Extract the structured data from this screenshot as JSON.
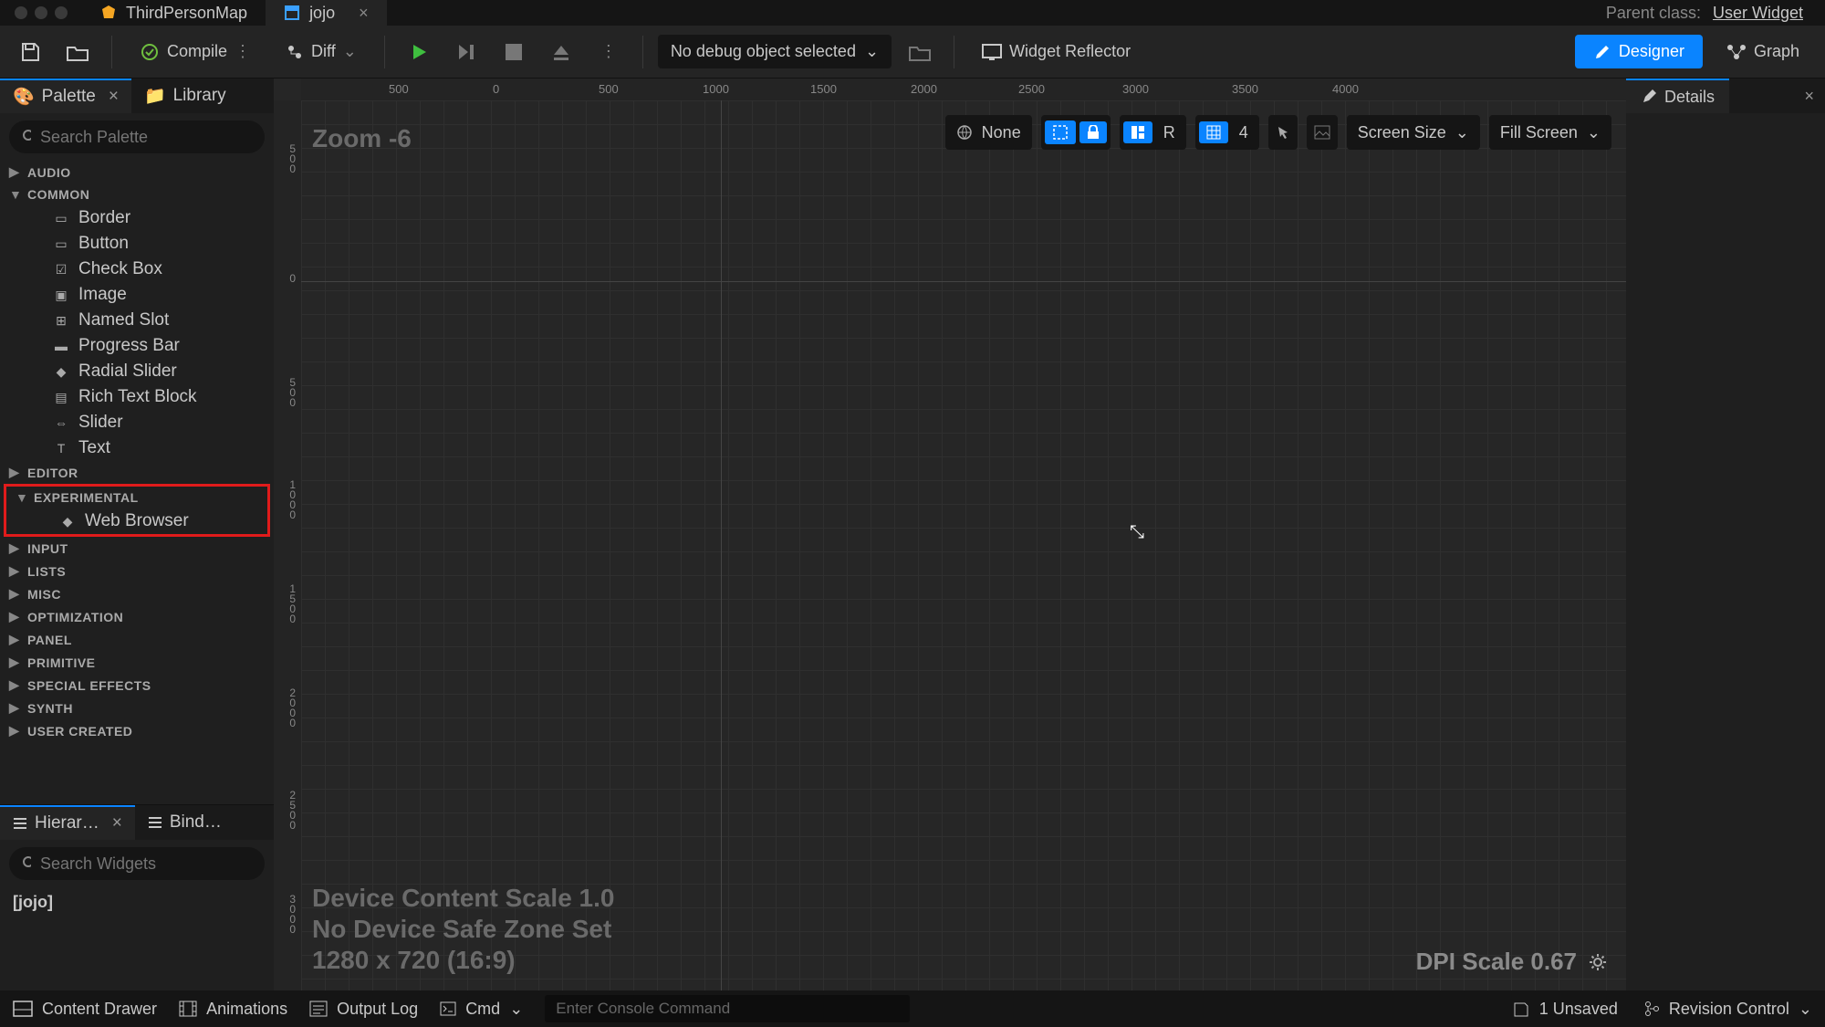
{
  "tabs": {
    "map": "ThirdPersonMap",
    "widget": "jojo"
  },
  "parent": {
    "label": "Parent class:",
    "value": "User Widget"
  },
  "toolbar": {
    "compile": "Compile",
    "diff": "Diff",
    "debug": "No debug object selected",
    "reflector": "Widget Reflector",
    "designer": "Designer",
    "graph": "Graph"
  },
  "palette": {
    "tab": "Palette",
    "library": "Library",
    "search_ph": "Search Palette",
    "cats": {
      "audio": "AUDIO",
      "common": "COMMON",
      "common_items": [
        "Border",
        "Button",
        "Check Box",
        "Image",
        "Named Slot",
        "Progress Bar",
        "Radial Slider",
        "Rich Text Block",
        "Slider",
        "Text"
      ],
      "editor": "EDITOR",
      "experimental": "EXPERIMENTAL",
      "experimental_items": [
        "Web Browser"
      ],
      "rest": [
        "INPUT",
        "LISTS",
        "MISC",
        "OPTIMIZATION",
        "PANEL",
        "PRIMITIVE",
        "SPECIAL EFFECTS",
        "SYNTH",
        "USER CREATED"
      ]
    }
  },
  "hierarchy": {
    "tab": "Hierar…",
    "bind": "Bind…",
    "search_ph": "Search Widgets",
    "root": "[jojo]"
  },
  "canvas": {
    "zoom": "Zoom -6",
    "h_ticks": [
      [
        "500",
        96
      ],
      [
        "0",
        210
      ],
      [
        "500",
        326
      ],
      [
        "1000",
        440
      ],
      [
        "1500",
        558
      ],
      [
        "2000",
        668
      ],
      [
        "2500",
        786
      ],
      [
        "3000",
        900
      ],
      [
        "3500",
        1020
      ],
      [
        "4000",
        1130
      ]
    ],
    "v_ticks": [
      [
        "500",
        48
      ],
      [
        "0",
        190
      ],
      [
        "500",
        304
      ],
      [
        "1000",
        416
      ],
      [
        "1500",
        530
      ],
      [
        "2000",
        644
      ],
      [
        "2500",
        756
      ],
      [
        "3000",
        870
      ]
    ],
    "none": "None",
    "r": "R",
    "grid4": "4",
    "screensize": "Screen Size",
    "fill": "Fill Screen",
    "footer1": "Device Content Scale 1.0",
    "footer2": "No Device Safe Zone Set",
    "footer3": "1280 x 720 (16:9)",
    "dpi": "DPI Scale 0.67"
  },
  "details": "Details",
  "bottom": {
    "drawer": "Content Drawer",
    "anim": "Animations",
    "output": "Output Log",
    "cmd": "Cmd",
    "console_ph": "Enter Console Command",
    "unsaved": "1 Unsaved",
    "rev": "Revision Control"
  }
}
